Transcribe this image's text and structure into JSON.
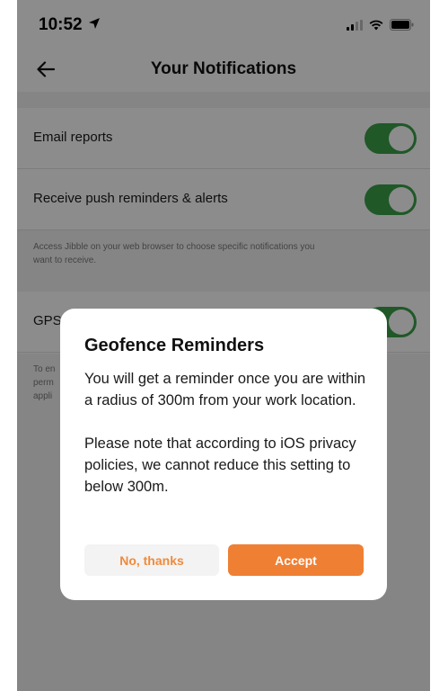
{
  "status_bar": {
    "time": "10:52",
    "location_icon": "location-arrow-icon",
    "signal_icon": "cellular-signal-icon",
    "wifi_icon": "wifi-icon",
    "battery_icon": "battery-icon"
  },
  "header": {
    "title": "Your Notifications",
    "back_icon": "arrow-left-icon"
  },
  "settings": {
    "email_reports": {
      "label": "Email reports",
      "enabled": true
    },
    "push_reminders": {
      "label": "Receive push reminders & alerts",
      "enabled": true
    },
    "web_help": "Access Jibble on your web browser to choose specific notifications you want to receive.",
    "gps": {
      "label": "GPS",
      "enabled": true
    },
    "gps_help": "To en perm appli"
  },
  "modal": {
    "title": "Geofence Reminders",
    "body_1": "You will get a reminder once you are within a radius of 300m from your work location.",
    "body_2": "Please note that according to iOS privacy policies, we cannot reduce this setting to below 300m.",
    "cancel_label": "No, thanks",
    "accept_label": "Accept"
  },
  "colors": {
    "toggle_on": "#3ba04a",
    "accent_orange": "#ef7f33",
    "overlay": "rgba(0,0,0,0.45)"
  }
}
